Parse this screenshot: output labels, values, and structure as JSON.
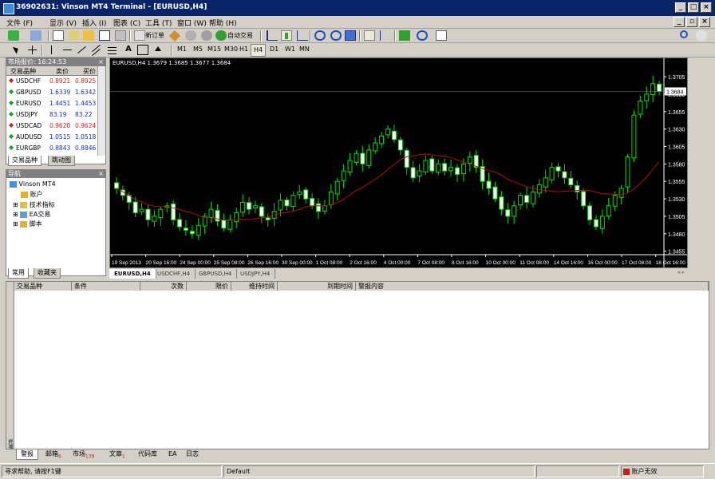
{
  "window": {
    "title": "36902631: Vinson MT4 Terminal - [EURUSD,H4]"
  },
  "menu": [
    "文件 (F)",
    "显示 (V)",
    "插入 (I)",
    "图表 (C)",
    "工具 (T)",
    "窗口 (W)",
    "帮助 (H)"
  ],
  "toolbar": {
    "new_order": "新订单",
    "auto_trading": "自动交易"
  },
  "timeframes": [
    "M1",
    "M5",
    "M15",
    "M30",
    "H1",
    "H4",
    "D1",
    "W1",
    "MN"
  ],
  "active_timeframe": "H4",
  "market_watch": {
    "title": "市场报价: 16:24:53",
    "headers": {
      "symbol": "交易品种",
      "bid": "卖价",
      "ask": "买价"
    },
    "rows": [
      {
        "symbol": "USDCHF",
        "bid": "0.8921",
        "ask": "0.8925",
        "dir": "down"
      },
      {
        "symbol": "GBPUSD",
        "bid": "1.6339",
        "ask": "1.6342",
        "dir": "up"
      },
      {
        "symbol": "EURUSD",
        "bid": "1.4451",
        "ask": "1.4453",
        "dir": "up"
      },
      {
        "symbol": "USDJPY",
        "bid": "83.19",
        "ask": "83.22",
        "dir": "up"
      },
      {
        "symbol": "USDCAD",
        "bid": "0.9620",
        "ask": "0.9624",
        "dir": "down"
      },
      {
        "symbol": "AUDUSD",
        "bid": "1.0515",
        "ask": "1.0518",
        "dir": "up"
      },
      {
        "symbol": "EURGBP",
        "bid": "0.8843",
        "ask": "0.8846",
        "dir": "up"
      }
    ],
    "tabs": [
      "交易品种",
      "跳动图"
    ]
  },
  "navigator": {
    "title": "导航",
    "root": "Vinson MT4",
    "items": [
      "账户",
      "技术指标",
      "EA交易",
      "脚本"
    ],
    "tabs": [
      "常用",
      "收藏夹"
    ]
  },
  "chart": {
    "header": "EURUSD,H4  1.3679 1.3685 1.3677 1.3684",
    "price_labels": [
      "1.3705",
      "1.3680",
      "1.3655",
      "1.3630",
      "1.3605",
      "1.3580",
      "1.3555",
      "1.3530",
      "1.3505",
      "1.3480",
      "1.3455"
    ],
    "current_price": "1.3684",
    "time_labels": [
      "19 Sep 2013",
      "20 Sep 16:00",
      "24 Sep 00:00",
      "25 Sep 08:00",
      "26 Sep 16:00",
      "30 Sep 00:00",
      "1 Oct 08:00",
      "2 Oct 16:00",
      "4 Oct 00:00",
      "7 Oct 08:00",
      "8 Oct 16:00",
      "10 Oct 00:00",
      "11 Oct 08:00",
      "14 Oct 16:00",
      "16 Oct 00:00",
      "17 Oct 08:00",
      "18 Oct 16:00"
    ],
    "tabs": [
      "EURUSD,H4",
      "USDCHF,H4",
      "GBPUSD,H4",
      "USDJPY,H4"
    ],
    "colors": {
      "bull": "#00e000",
      "bear": "#ffffff",
      "ma": "#b01010",
      "bg": "#000000"
    }
  },
  "chart_data": {
    "type": "candlestick",
    "symbol": "EURUSD",
    "timeframe": "H4",
    "ylim": [
      1.345,
      1.372
    ],
    "ma_shown": true,
    "closes_approx": [
      1.3545,
      1.3535,
      1.3525,
      1.351,
      1.3515,
      1.35,
      1.3505,
      1.3515,
      1.352,
      1.35,
      1.349,
      1.3485,
      1.348,
      1.3492,
      1.3505,
      1.3515,
      1.3498,
      1.3488,
      1.35,
      1.351,
      1.3525,
      1.3515,
      1.352,
      1.3505,
      1.35,
      1.3512,
      1.3528,
      1.352,
      1.3535,
      1.354,
      1.353,
      1.352,
      1.3512,
      1.352,
      1.354,
      1.3555,
      1.357,
      1.3585,
      1.3595,
      1.358,
      1.36,
      1.361,
      1.362,
      1.363,
      1.3615,
      1.36,
      1.3575,
      1.356,
      1.357,
      1.3585,
      1.357,
      1.358,
      1.357,
      1.3575,
      1.3565,
      1.358,
      1.359,
      1.3575,
      1.3555,
      1.3545,
      1.353,
      1.3515,
      1.3505,
      1.352,
      1.3535,
      1.3525,
      1.354,
      1.355,
      1.356,
      1.3575,
      1.357,
      1.356,
      1.355,
      1.354,
      1.352,
      1.35,
      1.349,
      1.3505,
      1.352,
      1.3535,
      1.3545,
      1.359,
      1.365,
      1.367,
      1.368,
      1.3695,
      1.3684
    ]
  },
  "terminal": {
    "headers": [
      "交易品种",
      "条件",
      "次数",
      "限价",
      "维持时间",
      "到期时间",
      "警报内容"
    ],
    "tabs": [
      {
        "label": "警报",
        "badge": ""
      },
      {
        "label": "邮箱",
        "badge": "6"
      },
      {
        "label": "市场",
        "badge": "139"
      },
      {
        "label": "文章",
        "badge": "1"
      },
      {
        "label": "代码库",
        "badge": ""
      },
      {
        "label": "EA",
        "badge": ""
      },
      {
        "label": "日志",
        "badge": ""
      }
    ],
    "side_label": "终端"
  },
  "status": {
    "help": "寻求帮助, 请按F1键",
    "profile": "Default",
    "connection": "账户无效"
  }
}
